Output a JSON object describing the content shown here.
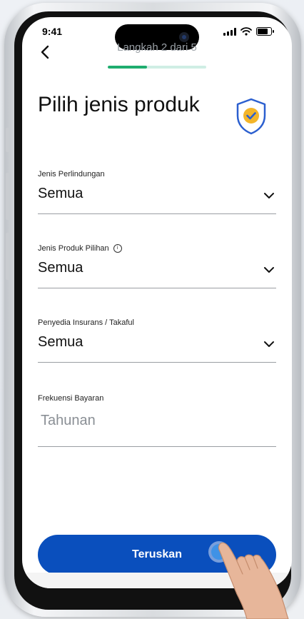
{
  "status_bar": {
    "time": "9:41"
  },
  "header": {
    "step_label": "Langkah 2 dari 5",
    "progress": 0.4
  },
  "page": {
    "title": "Pilih jenis produk"
  },
  "form": {
    "protection_type": {
      "label": "Jenis Perlindungan",
      "value": "Semua"
    },
    "product_type": {
      "label": "Jenis Produk Pilihan",
      "value": "Semua",
      "info_icon": "info-icon"
    },
    "provider": {
      "label": "Penyedia Insurans / Takaful",
      "value": "Semua"
    },
    "payment_frequency": {
      "label": "Frekuensi Bayaran",
      "value": "Tahunan"
    }
  },
  "actions": {
    "continue_label": "Teruskan"
  },
  "colors": {
    "primary": "#0a4fbd",
    "progress": "#1fad6f",
    "progress_track": "#cfeee4",
    "shield": "#2b5fcf",
    "check": "#f3b52a"
  }
}
